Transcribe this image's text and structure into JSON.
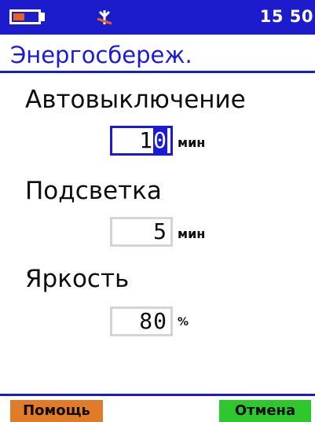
{
  "status_bar": {
    "battery_level": 0.45,
    "battery_color": "#e8631a",
    "signal_icon": "antenna-crossed-icon",
    "time": "15 50"
  },
  "title": "Энергосбереж.",
  "fields": [
    {
      "label": "Автовыключение",
      "value_prefix": "1",
      "value_cursor": "0",
      "unit": "мин",
      "active": true
    },
    {
      "label": "Подсветка",
      "value": "5",
      "unit": "мин",
      "active": false
    },
    {
      "label": "Яркость",
      "value": "80",
      "unit": "%",
      "active": false
    }
  ],
  "softkeys": {
    "help": "Помощь",
    "cancel": "Отмена"
  },
  "colors": {
    "bar_blue": "#1c1ccc",
    "title_blue": "#1a1ad8",
    "help_orange": "#e07b2a",
    "cancel_green": "#2ec82e"
  }
}
